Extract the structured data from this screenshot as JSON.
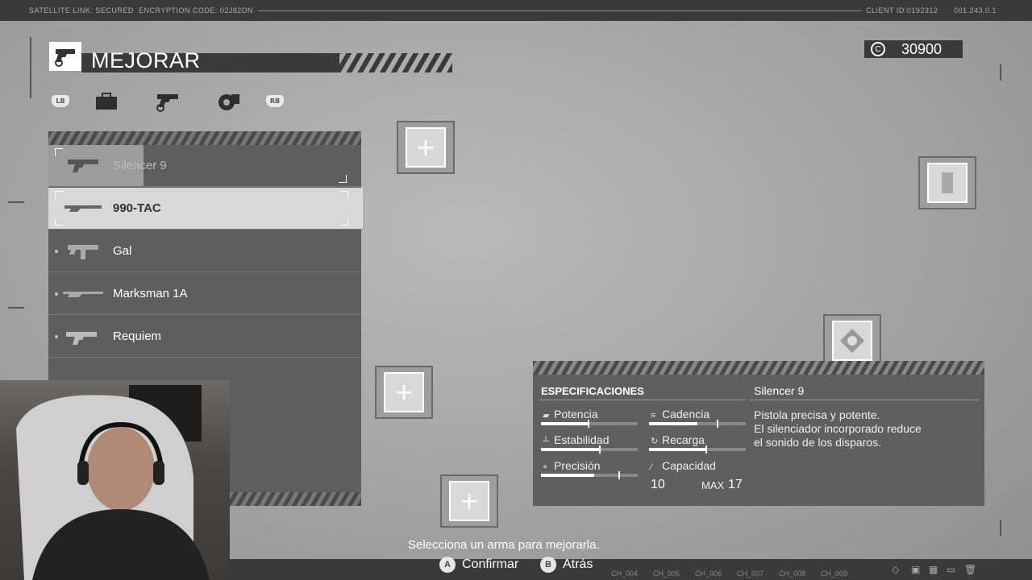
{
  "topbar": {
    "satellite": "SATELLITE LINK: SECURED",
    "encryption": "ENCRYPTION CODE: 02J82DN",
    "client": "CLIENT ID:0192312",
    "version": "001.243.0.1"
  },
  "header": {
    "title": "MEJORAR",
    "credits_symbol": "C",
    "credits": "30900"
  },
  "tabs": {
    "left_button": "LB",
    "right_button": "RB",
    "items": [
      "briefcase-icon",
      "pistol-gear-icon",
      "money-gear-icon"
    ]
  },
  "weapons": [
    {
      "name": "Silencer 9",
      "state": "current"
    },
    {
      "name": "990-TAC",
      "state": "selected"
    },
    {
      "name": "Gal",
      "state": "new"
    },
    {
      "name": "Marksman 1A",
      "state": "new"
    },
    {
      "name": "Requiem",
      "state": "new"
    }
  ],
  "slots": {
    "add_symbol": "+"
  },
  "specs": {
    "title": "ESPECIFICACIONES",
    "weapon_name": "Silencer 9",
    "description": [
      "Pistola precisa y potente.",
      "El silenciador incorporado reduce",
      "el sonido de los disparos."
    ],
    "stats": [
      {
        "label": "Potencia",
        "value": 0.48,
        "mark": 0.48
      },
      {
        "label": "Cadencia",
        "value": 0.5,
        "mark": 0.7
      },
      {
        "label": "Estabilidad",
        "value": 0.6,
        "mark": 0.6
      },
      {
        "label": "Recarga",
        "value": 0.58,
        "mark": 0.58
      },
      {
        "label": "Precisión",
        "value": 0.55,
        "mark": 0.8
      }
    ],
    "capacity_label": "Capacidad",
    "capacity": "10",
    "max_label": "MAX",
    "max": "17"
  },
  "footer": {
    "hint": "Selecciona un arma para mejorarla.",
    "confirm_key": "A",
    "confirm": "Confirmar",
    "back_key": "B",
    "back": "Atrás",
    "channels": [
      "CH_004",
      "CH_005",
      "CH_006",
      "CH_007",
      "CH_008",
      "CH_009"
    ]
  },
  "colors": {
    "panel": "#5e5e5e",
    "dark": "#3a3a3a",
    "accent": "#bcd27a"
  }
}
